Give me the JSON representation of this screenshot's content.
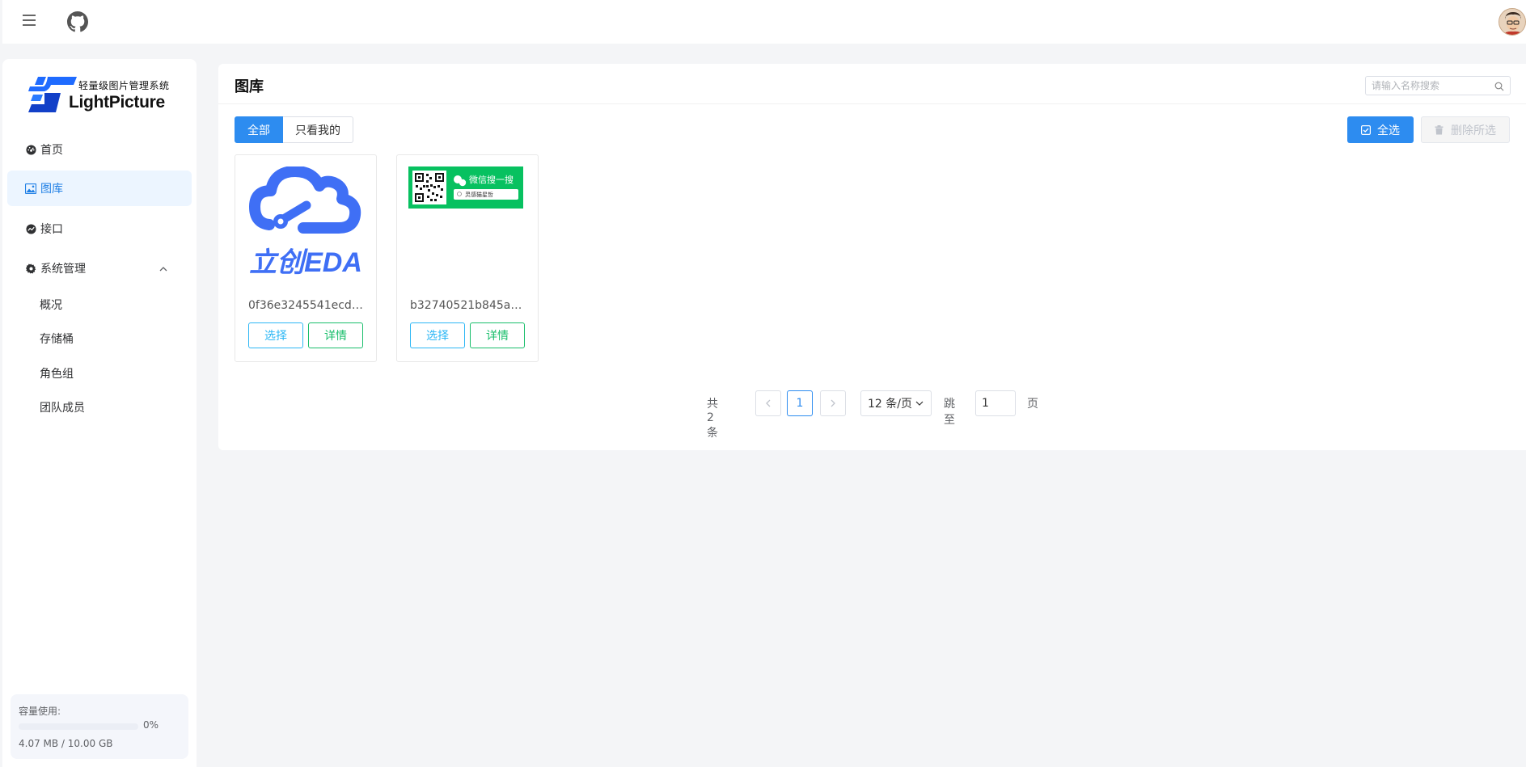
{
  "header": {
    "menu_icon": "hamburger-icon",
    "github_icon": "github-icon",
    "avatar_icon": "user-avatar"
  },
  "sidebar": {
    "logo_subtitle": "轻量级图片管理系统",
    "logo_title": "LightPicture",
    "items": [
      {
        "label": "首页",
        "icon": "dashboard-icon"
      },
      {
        "label": "图库",
        "icon": "image-icon"
      },
      {
        "label": "接口",
        "icon": "api-icon"
      },
      {
        "label": "系统管理",
        "icon": "gear-icon"
      }
    ],
    "sub_items": [
      {
        "label": "概况"
      },
      {
        "label": "存储桶"
      },
      {
        "label": "角色组"
      },
      {
        "label": "团队成员"
      }
    ],
    "quota": {
      "title": "容量使用:",
      "percent_label": "0%",
      "percent_value": 0,
      "size_label": "4.07 MB / 10.00 GB"
    }
  },
  "main": {
    "title": "图库",
    "search_placeholder": "请输入名称搜索",
    "filters": [
      {
        "label": "全部",
        "active": true
      },
      {
        "label": "只看我的",
        "active": false
      }
    ],
    "select_all_label": "全选",
    "delete_selected_label": "删除所选",
    "cards": [
      {
        "name": "0f36e3245541ecde....",
        "select_label": "选择",
        "detail_label": "详情",
        "image_text": "立创EDA"
      },
      {
        "name": "b32740521b845ad...",
        "select_label": "选择",
        "detail_label": "详情",
        "image_text": "微信搜一搜",
        "image_subtext": "灵感猫星哲"
      }
    ],
    "pagination": {
      "total_label": "共 2 条",
      "current_page": "1",
      "page_size_label": "12 条/页",
      "jump_label": "跳至",
      "jump_value": "1",
      "page_suffix": "页"
    }
  },
  "colors": {
    "primary": "#2d8cf0",
    "info": "#2db7f5",
    "success": "#19be6b",
    "active_nav_bg": "#ecf5ff"
  }
}
